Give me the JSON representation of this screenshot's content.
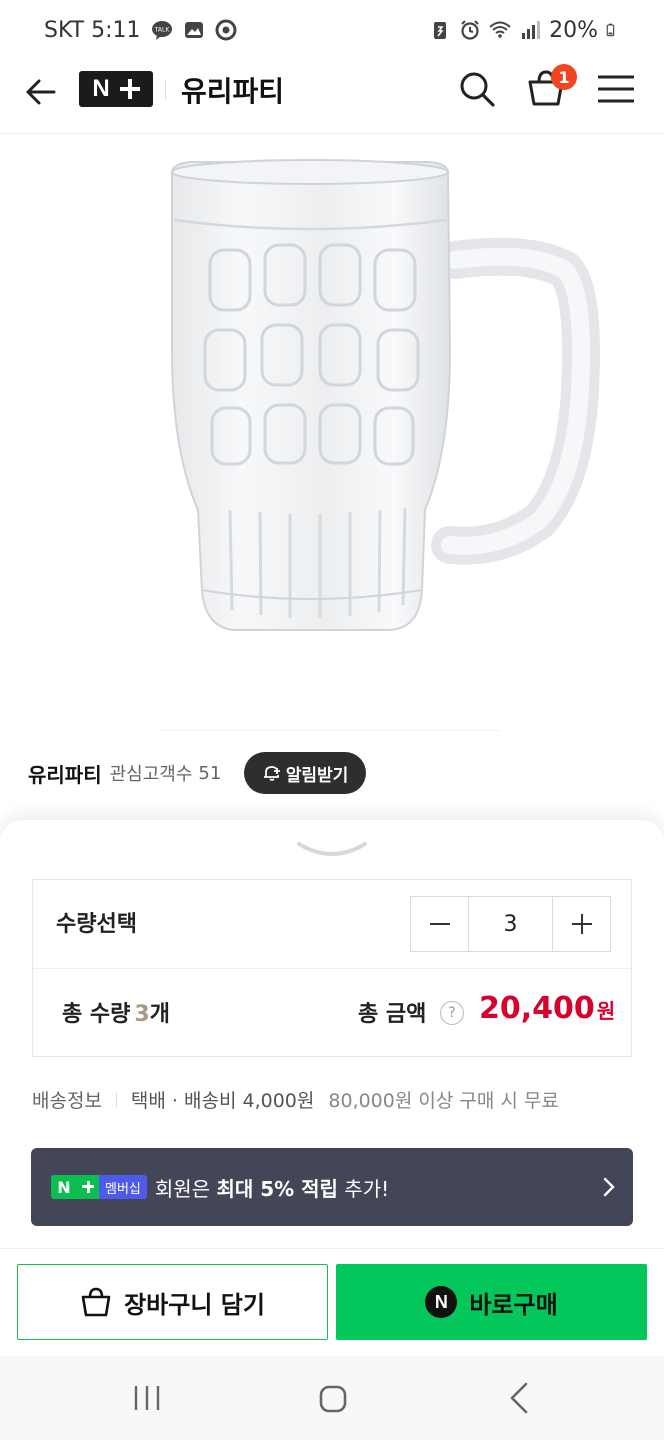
{
  "status_bar": {
    "carrier_time": "SKT 5:11",
    "battery": "20%",
    "left_icons": [
      "kakaotalk-icon",
      "gallery-icon",
      "chrome-icon"
    ],
    "right_icons": [
      "battery-saver-icon",
      "alarm-icon",
      "wifi-icon",
      "signal-icon",
      "battery-icon"
    ]
  },
  "header": {
    "store_title": "유리파티",
    "cart_count": "1",
    "icons": [
      "back-arrow-icon",
      "nplus-logo",
      "search-icon",
      "cart-icon",
      "menu-icon"
    ]
  },
  "store": {
    "name": "유리파티",
    "followers_label": "관심고객수",
    "followers_count": "51",
    "alarm_label": "알림받기"
  },
  "option": {
    "qty_label": "수량선택",
    "qty_value": "3",
    "total_qty_prefix": "총 수량",
    "total_qty_num": "3",
    "total_qty_suffix": "개",
    "total_price_label": "총 금액",
    "total_price": "20,400",
    "total_price_unit": "원"
  },
  "shipping": {
    "label": "배송정보",
    "method": "택배 · 배송비 4,000원",
    "free_condition": "80,000원 이상 구매 시 무료"
  },
  "banner": {
    "badge_tag": "멤버십",
    "text_pre": "회원은 ",
    "text_bold": "최대 5% 적립",
    "text_post": " 추가!"
  },
  "actions": {
    "cart_label": "장바구니 담기",
    "buy_label": "바로구매"
  },
  "colors": {
    "price_red": "#d8002c",
    "naver_green": "#03c75a",
    "banner_bg": "#434656",
    "badge_orange": "#f1451f"
  }
}
